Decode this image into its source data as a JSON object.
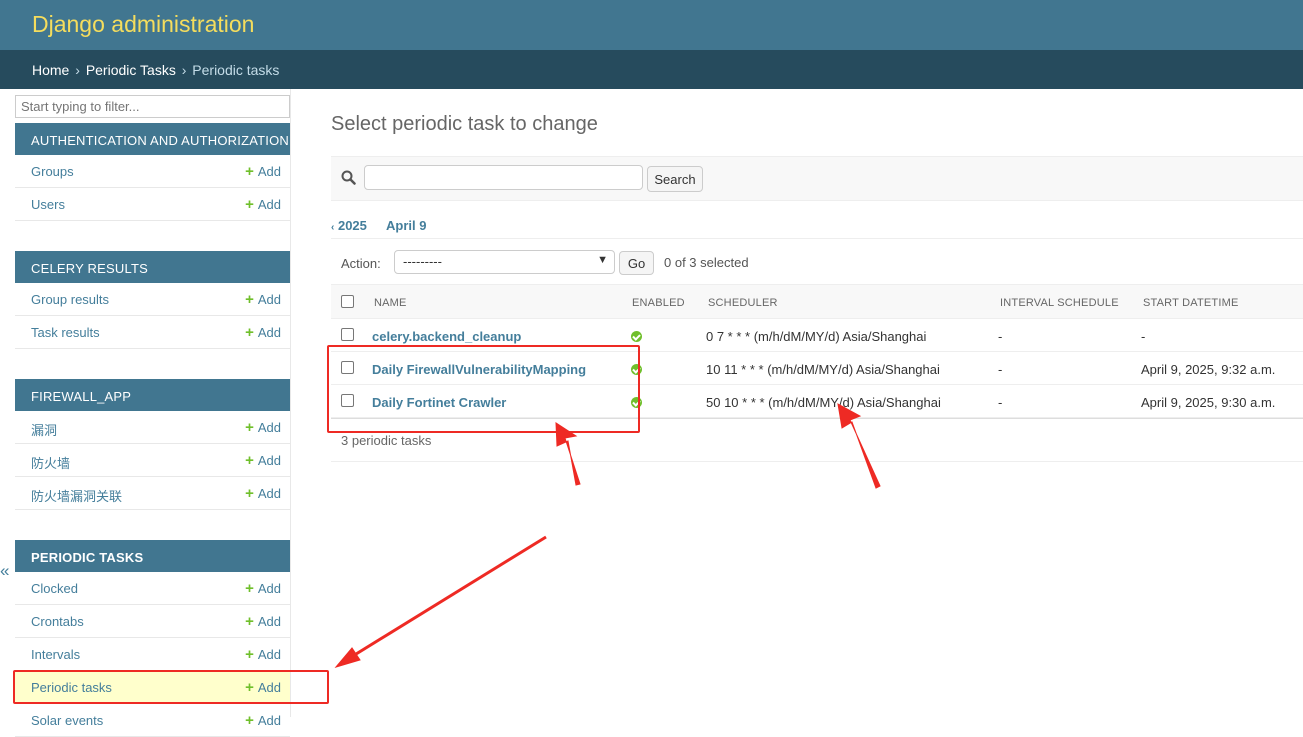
{
  "header": {
    "site_name": "Django administration"
  },
  "breadcrumbs": {
    "home": "Home",
    "app": "Periodic Tasks",
    "current": "Periodic tasks",
    "sep": "›"
  },
  "sidebar": {
    "filter_placeholder": "Start typing to filter...",
    "collapse_label": "«",
    "add_label": "Add",
    "modules": [
      {
        "caption": "AUTHENTICATION AND AUTHORIZATION",
        "models": [
          "Groups",
          "Users"
        ]
      },
      {
        "caption": "CELERY RESULTS",
        "models": [
          "Group results",
          "Task results"
        ]
      },
      {
        "caption": "FIREWALL_APP",
        "models": [
          "漏洞",
          "防火墙",
          "防火墙漏洞关联"
        ]
      },
      {
        "caption": "PERIODIC TASKS",
        "models": [
          "Clocked",
          "Crontabs",
          "Intervals",
          "Periodic tasks",
          "Solar events"
        ]
      }
    ]
  },
  "content": {
    "title": "Select periodic task to change",
    "search_button": "Search",
    "date_hierarchy": {
      "prev": "2025",
      "prev_arrow": "‹",
      "current": "April 9"
    },
    "actions": {
      "label": "Action:",
      "selected": "---------",
      "go": "Go",
      "counter": "0 of 3 selected"
    },
    "columns": [
      "Name",
      "Enabled",
      "Scheduler",
      "Interval schedule",
      "Start datetime"
    ],
    "rows": [
      {
        "name": "celery.backend_cleanup",
        "enabled": true,
        "scheduler": "0 7 * * * (m/h/dM/MY/d) Asia/Shanghai",
        "interval": "-",
        "start": "-"
      },
      {
        "name": "Daily FirewallVulnerabilityMapping",
        "enabled": true,
        "scheduler": "10 11 * * * (m/h/dM/MY/d) Asia/Shanghai",
        "interval": "-",
        "start": "April 9, 2025, 9:32 a.m."
      },
      {
        "name": "Daily Fortinet Crawler",
        "enabled": true,
        "scheduler": "50 10 * * * (m/h/dM/MY/d) Asia/Shanghai",
        "interval": "-",
        "start": "April 9, 2025, 9:30 a.m."
      }
    ],
    "paginator": "3 periodic tasks"
  },
  "colors": {
    "header": "#417690",
    "breadcrumbs": "#264b5d",
    "brand": "#f5dd5d",
    "link": "#447e9b",
    "add_plus": "#70bf2b",
    "annotation": "#ee2a24",
    "current_row": "#ffffcc"
  }
}
